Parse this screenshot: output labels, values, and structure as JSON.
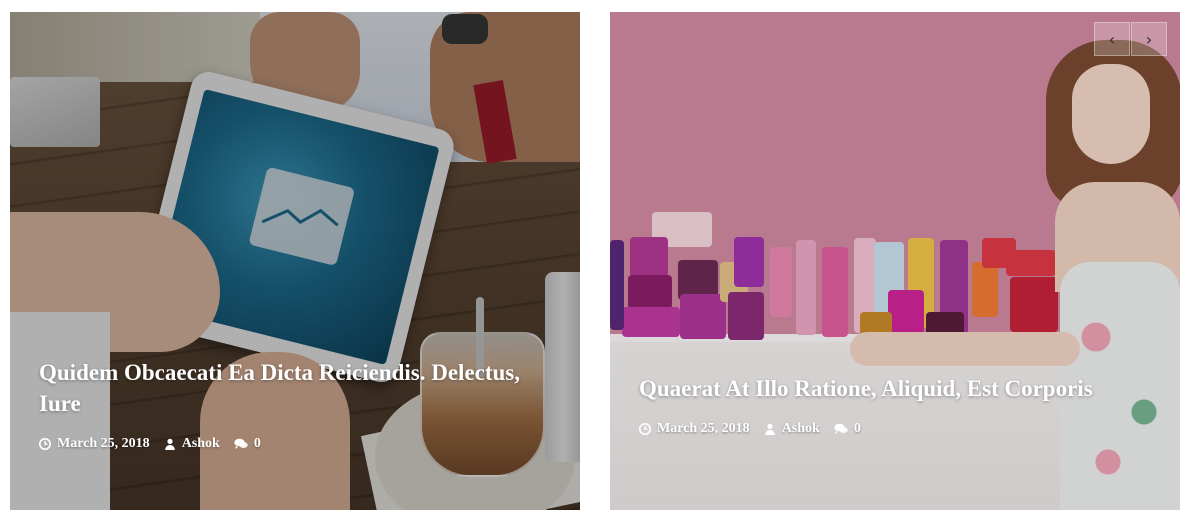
{
  "posts": [
    {
      "title": "Quidem Obcaecati Ea Dicta Reiciendis. Delectus, Iure",
      "date": "March 25, 2018",
      "author": "Ashok",
      "comments": "0",
      "image_icon": "tablet-finance-photo"
    },
    {
      "title": "Quaerat At Illo Ratione, Aliquid, Est Corporis",
      "date": "March 25, 2018",
      "author": "Ashok",
      "comments": "0",
      "image_icon": "cosmetics-model-photo"
    }
  ],
  "slider": {
    "prev_icon": "chevron-left-icon",
    "next_icon": "chevron-right-icon",
    "prev_glyph": "‹",
    "next_glyph": "›"
  },
  "colors": {
    "text": "#ffffff",
    "pink_backdrop": "#d38aa3"
  }
}
